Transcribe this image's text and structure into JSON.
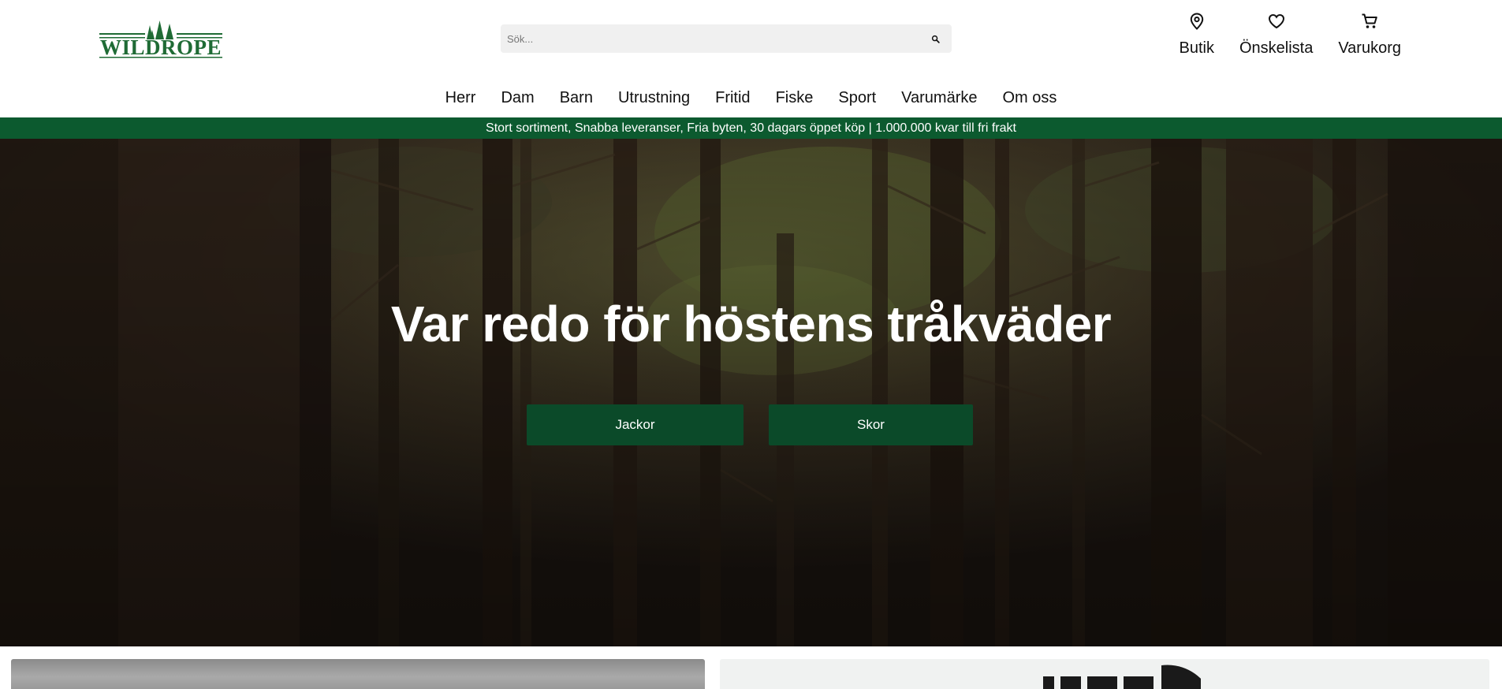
{
  "header": {
    "logo_text": "WILDROPE",
    "search_placeholder": "Sök...",
    "actions": [
      {
        "label": "Butik",
        "icon": "location-pin-icon"
      },
      {
        "label": "Önskelista",
        "icon": "heart-icon"
      },
      {
        "label": "Varukorg",
        "icon": "cart-icon"
      }
    ]
  },
  "nav": {
    "items": [
      "Herr",
      "Dam",
      "Barn",
      "Utrustning",
      "Fritid",
      "Fiske",
      "Sport",
      "Varumärke",
      "Om oss"
    ]
  },
  "strip": {
    "text": "Stort sortiment, Snabba leveranser, Fria byten, 30 dagars öppet köp | 1.000.000 kvar till fri frakt"
  },
  "hero": {
    "title": "Var redo för höstens tråkväder",
    "buttons": [
      "Jackor",
      "Skor"
    ]
  },
  "colors": {
    "brand_green": "#1f6b35",
    "strip_green": "#0c5a2f",
    "button_green": "#0b4a29"
  }
}
